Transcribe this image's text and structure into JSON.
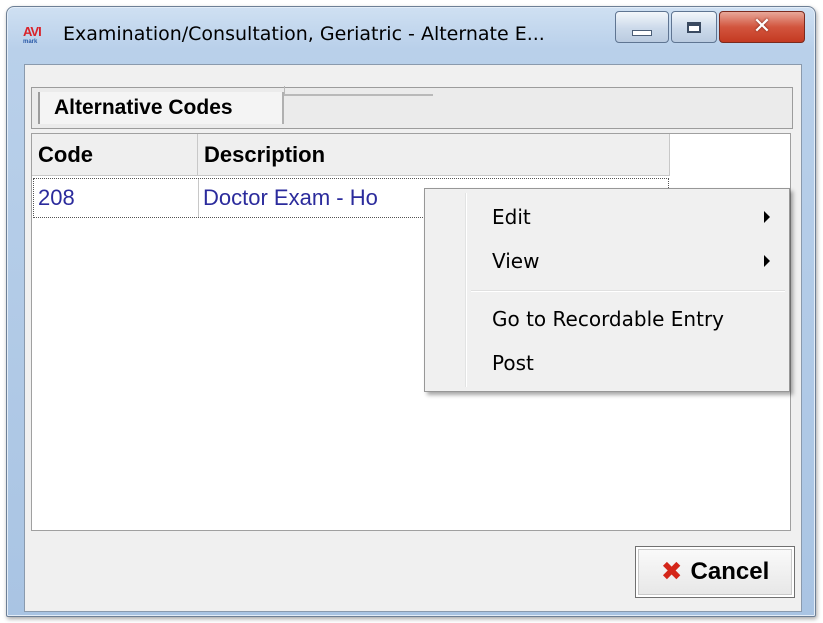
{
  "window": {
    "app_icon_text": "AVI",
    "app_icon_subtext": "mark",
    "title": "Examination/Consultation, Geriatric - Alternate E..."
  },
  "tabs": [
    {
      "label": "Alternative Codes"
    }
  ],
  "table": {
    "columns": [
      "Code",
      "Description"
    ],
    "rows": [
      {
        "code": "208",
        "description": "Doctor Exam - Ho"
      }
    ]
  },
  "context_menu": {
    "items": [
      {
        "label": "Edit",
        "has_submenu": true
      },
      {
        "label": "View",
        "has_submenu": true
      },
      {
        "label": "Go to Recordable Entry",
        "has_submenu": false
      },
      {
        "label": "Post",
        "has_submenu": false
      }
    ]
  },
  "footer": {
    "cancel_label": "Cancel",
    "cancel_icon": "red-x-icon"
  },
  "colors": {
    "cell_text": "#2b2b9c",
    "cancel_icon": "#d42619",
    "close_button": "#c43a22"
  }
}
